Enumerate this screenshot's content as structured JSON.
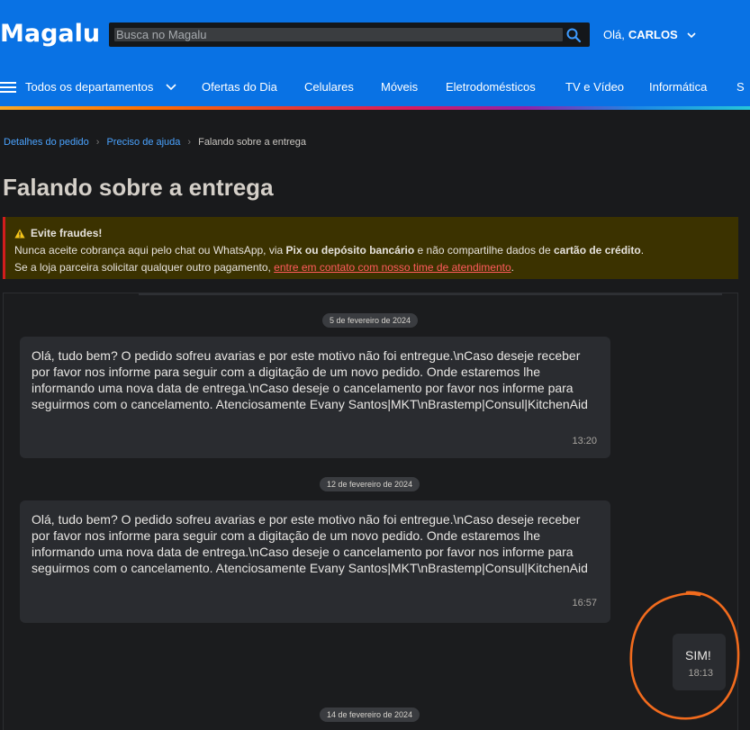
{
  "header": {
    "logo": "Magalu",
    "search_placeholder": "Busca no Magalu",
    "greeting_prefix": "Olá,",
    "user_name": "CARLOS",
    "nav": {
      "all_departments": "Todos os departamentos",
      "items": [
        "Ofertas do Dia",
        "Celulares",
        "Móveis",
        "Eletrodomésticos",
        "TV e Vídeo",
        "Informática",
        "S"
      ]
    }
  },
  "breadcrumb": {
    "items": [
      "Detalhes do pedido",
      "Preciso de ajuda"
    ],
    "current": "Falando sobre a entrega"
  },
  "page_title": "Falando sobre a entrega",
  "warning": {
    "title": "Evite fraudes!",
    "line1_a": "Nunca aceite cobrança aqui pelo chat ou WhatsApp, via ",
    "line1_b": "Pix ou depósito bancário",
    "line1_c": " e não compartilhe dados de ",
    "line1_d": "cartão de crédito",
    "line1_e": ".",
    "line2_a": "Se a loja parceira solicitar qualquer outro pagamento, ",
    "line2_link": "entre em contato com nosso time de atendimento",
    "line2_b": "."
  },
  "chat": {
    "dates": [
      "5 de fevereiro de 2024",
      "12 de fevereiro de 2024",
      "14 de fevereiro de 2024"
    ],
    "messages": [
      {
        "text": "Olá, tudo bem? O pedido sofreu avarias e por este motivo não foi entregue.\\nCaso deseje receber por favor nos informe para seguir com a digitação de um novo pedido. Onde estaremos lhe informando uma nova data de entrega.\\nCaso deseje o cancelamento por favor nos informe para seguirmos com o cancelamento. Atenciosamente Evany Santos|MKT\\nBrastemp|Consul|KitchenAid",
        "time": "13:20"
      },
      {
        "text": "Olá, tudo bem? O pedido sofreu avarias e por este motivo não foi entregue.\\nCaso deseje receber por favor nos informe para seguir com a digitação de um novo pedido. Onde estaremos lhe informando uma nova data de entrega.\\nCaso deseje o cancelamento por favor nos informe para seguirmos com o cancelamento. Atenciosamente Evany Santos|MKT\\nBrastemp|Consul|KitchenAid",
        "time": "16:57"
      },
      {
        "text": "SIM!",
        "time": "18:13"
      }
    ]
  },
  "colors": {
    "header_blue": "#0972e4",
    "link_blue": "#4aa3ff",
    "warning_bg": "#3b3200",
    "warning_border": "#d21d1d",
    "annotation_orange": "#f26b1d"
  }
}
